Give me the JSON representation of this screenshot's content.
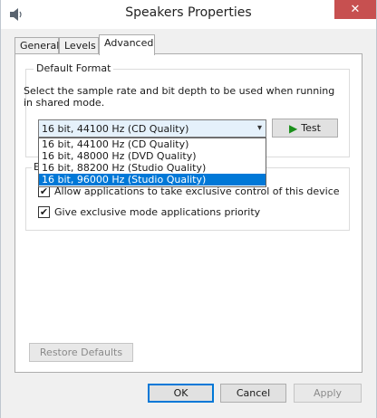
{
  "window": {
    "title": "Speakers Properties",
    "close_label": "✕"
  },
  "tabs": [
    {
      "label": "General",
      "active": false
    },
    {
      "label": "Levels",
      "active": false
    },
    {
      "label": "Advanced",
      "active": true
    }
  ],
  "default_format": {
    "group_title": "Default Format",
    "description": "Select the sample rate and bit depth to be used when running in shared mode.",
    "selected_value": "16 bit, 44100 Hz (CD Quality)",
    "test_label": "Test",
    "options": [
      "16 bit, 44100 Hz (CD Quality)",
      "16 bit, 48000 Hz (DVD Quality)",
      "16 bit, 88200 Hz (Studio Quality)",
      "16 bit, 96000 Hz (Studio Quality)"
    ],
    "highlighted_option_index": 3
  },
  "exclusive_mode": {
    "group_title_partial": "E",
    "allow_exclusive_label": "Allow applications to take exclusive control of this device",
    "allow_exclusive_checked": true,
    "priority_label": "Give exclusive mode applications priority",
    "priority_checked": true
  },
  "restore_defaults_label": "Restore Defaults",
  "footer": {
    "ok_label": "OK",
    "cancel_label": "Cancel",
    "apply_label": "Apply"
  },
  "colors": {
    "accent": "#0078d7",
    "close": "#c75050",
    "play_icon": "#1a8f1a"
  }
}
